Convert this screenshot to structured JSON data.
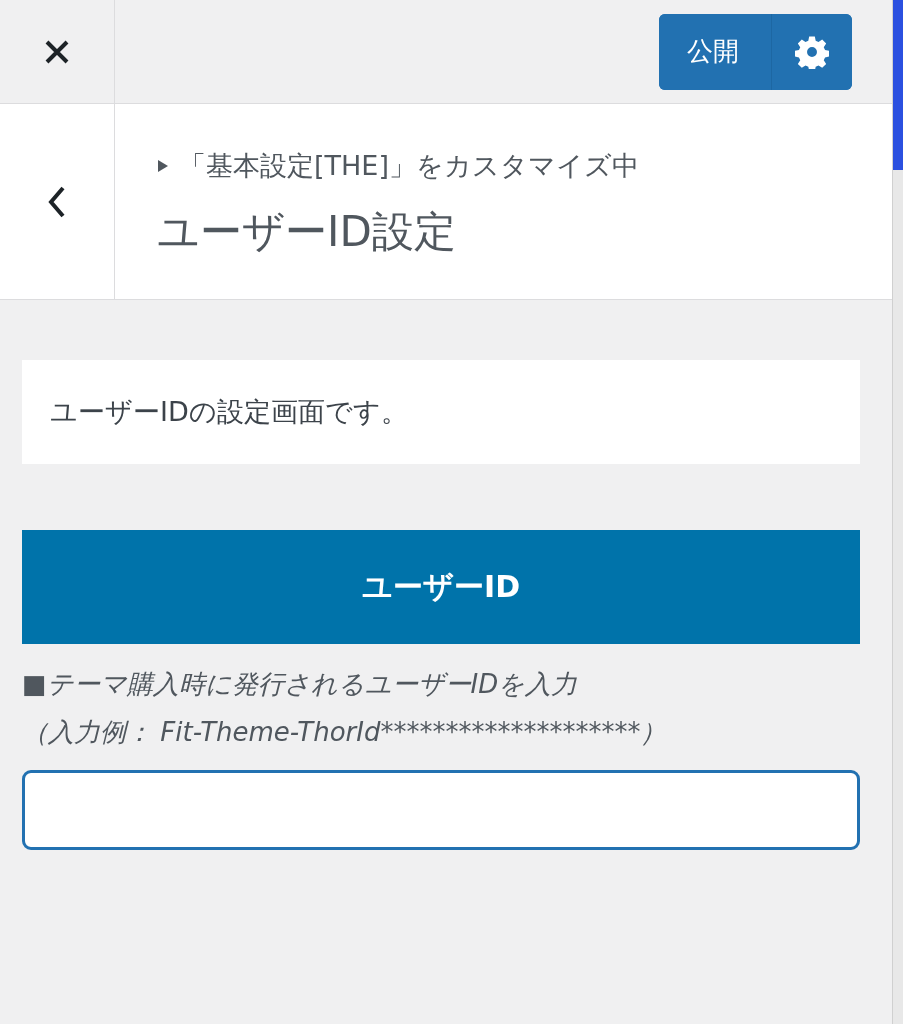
{
  "header": {
    "publish_button": "公開"
  },
  "section": {
    "breadcrumb": "「基本設定[THE]」をカスタマイズ中",
    "title": "ユーザーID設定"
  },
  "description": "ユーザーIDの設定画面です。",
  "control": {
    "heading": "ユーザーID",
    "hint_lines": [
      "■テーマ購入時に発行されるユーザーIDを入力",
      "（入力例： Fit-Theme-ThorId********************）"
    ]
  }
}
